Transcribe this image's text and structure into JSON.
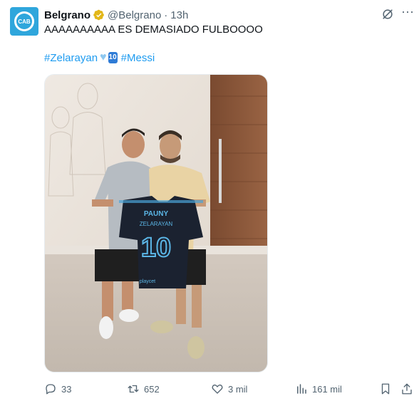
{
  "tweet": {
    "author_name": "Belgrano",
    "handle": "@Belgrano",
    "separator": "·",
    "time": "13h",
    "text": "AAAAAAAAAA ES DEMASIADO FULBOOOO",
    "hashtag1": "#Zelarayan",
    "emoji_heart": "💙",
    "emoji_keycap": "10",
    "hashtag2": "#Messi"
  },
  "photo": {
    "jersey_sponsor": "PAUNY",
    "jersey_name": "ZELARAYAN",
    "jersey_number": "10",
    "jersey_footer": "playcet"
  },
  "actions": {
    "replies": "33",
    "reposts": "652",
    "likes": "3 mil",
    "views": "161 mil"
  },
  "colors": {
    "accent": "#1d9bf0",
    "muted": "#536471",
    "verified": "#e2b719",
    "avatar_bg": "#2fa6dc"
  }
}
